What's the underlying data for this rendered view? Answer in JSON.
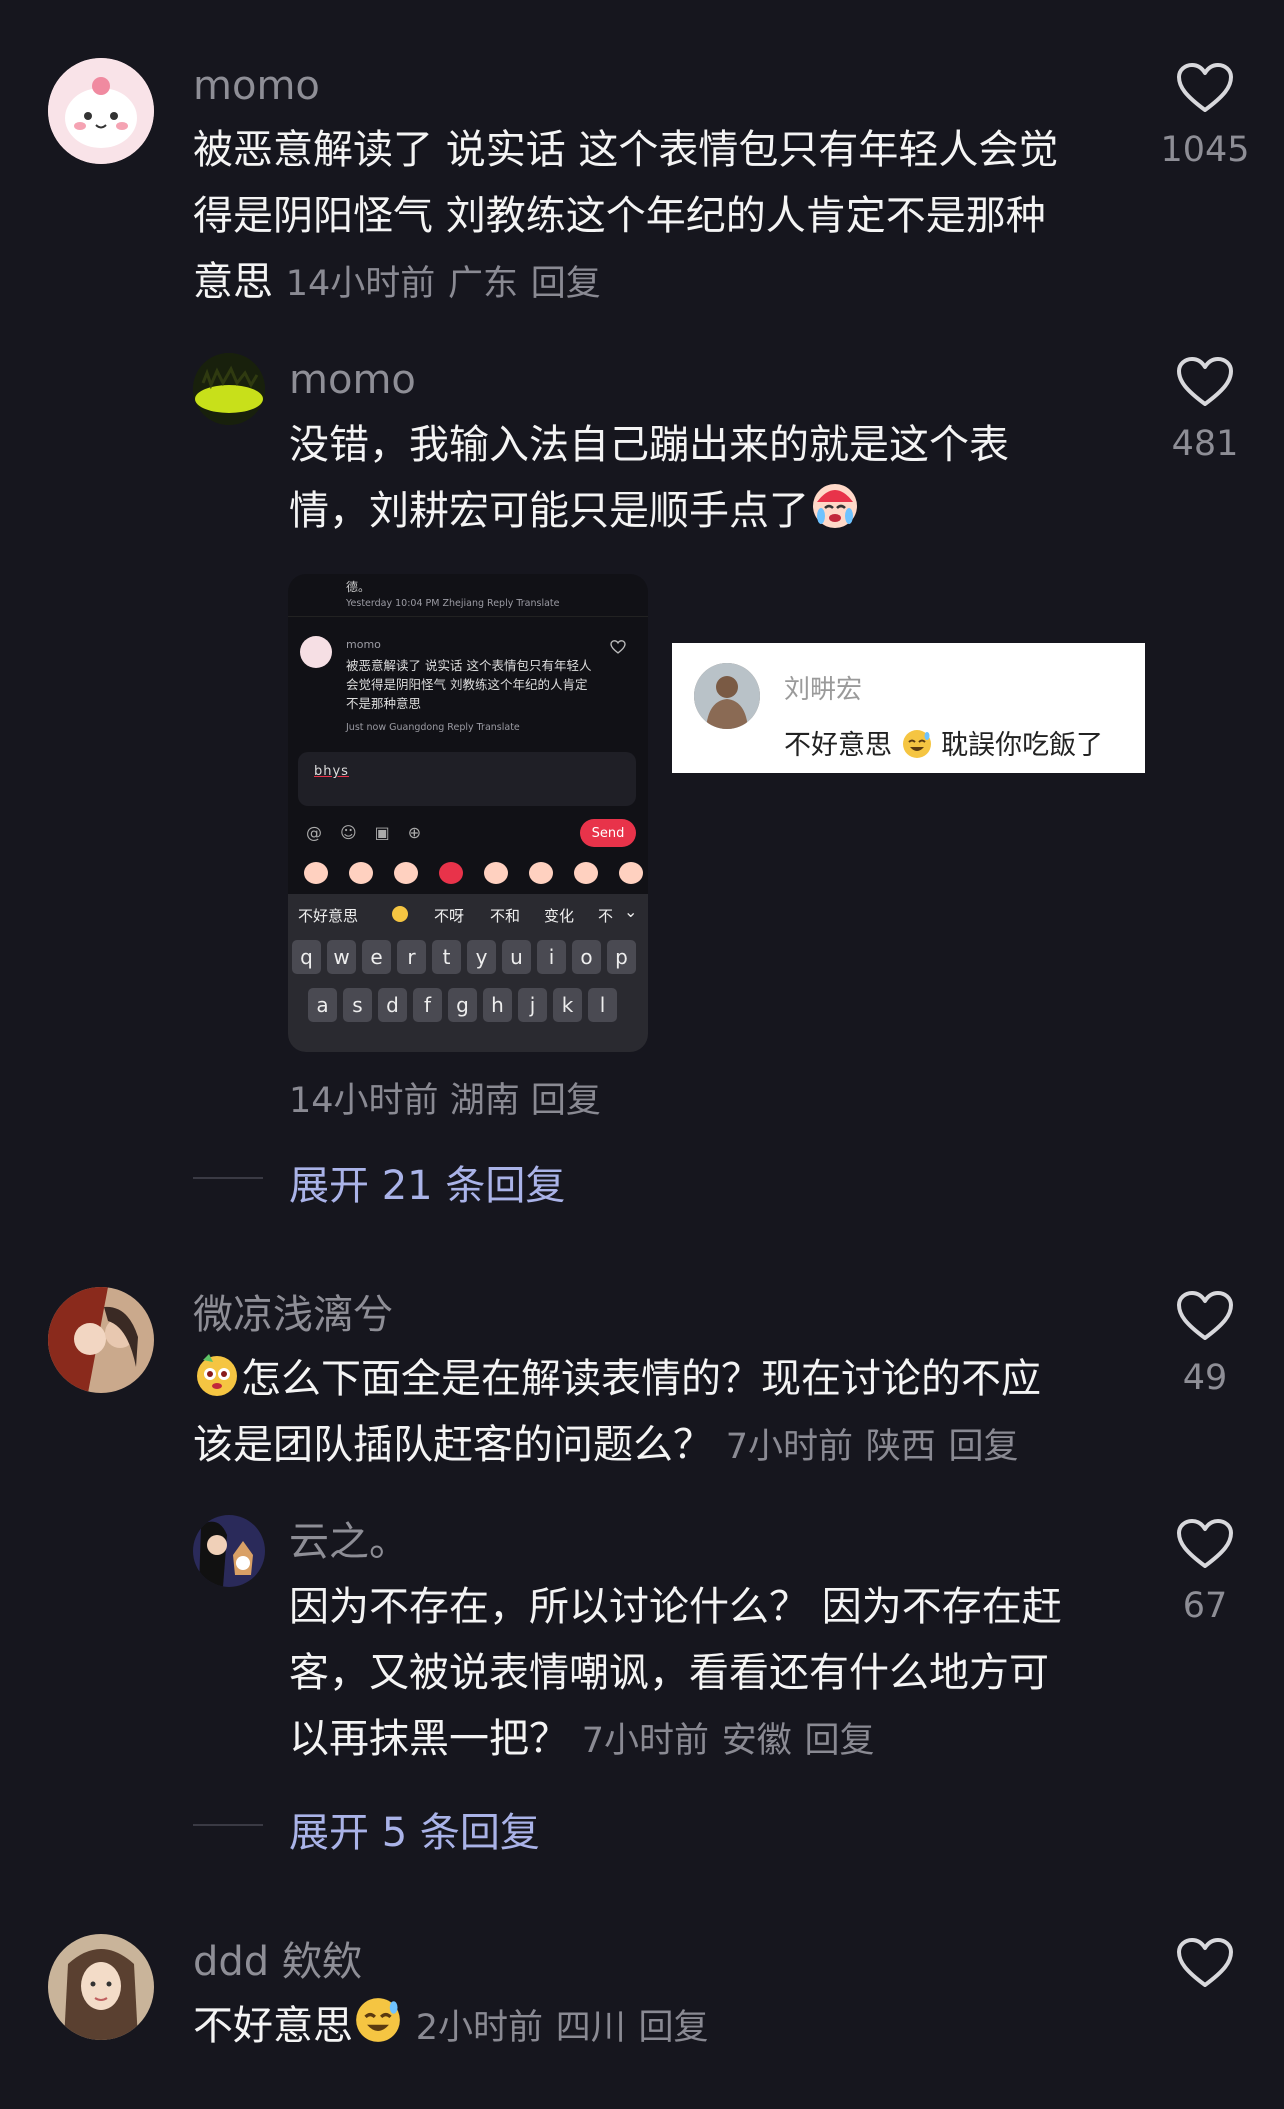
{
  "comments": [
    {
      "username": "momo",
      "text": "被恶意解读了 说实话 这个表情包只有年轻人会觉得是阴阳怪气 刘教练这个年纪的人肯定不是那种意思",
      "line1": "被恶意解读了 说实话 这个表情包只有年轻人会觉",
      "line2": "得是阴阳怪气 刘教练这个年纪的人肯定不是那种",
      "line3": "意思",
      "time": "14小时前",
      "location": "广东",
      "reply": "回复",
      "likes": "1045"
    },
    {
      "username": "momo",
      "line1": "没错，我输入法自己蹦出来的就是这个表",
      "line2": "情，刘耕宏可能只是顺手点了",
      "time": "14小时前",
      "location": "湖南",
      "reply": "回复",
      "likes": "481",
      "screenshot": {
        "top_char": "德。",
        "meta1": "Yesterday 10:04 PM Zhejiang Reply Translate",
        "inner_user": "momo",
        "inner_l1": "被恶意解读了 说实话 这个表情包只有年轻人",
        "inner_l2": "会觉得是阴阳怪气 刘教练这个年纪的人肯定",
        "inner_l3": "不是那种意思",
        "meta2": "Just now Guangdong Reply Translate",
        "input": "bhys",
        "send": "Send",
        "candidates": [
          "不好意思",
          "不呀",
          "不和",
          "变化",
          "不"
        ],
        "row1": [
          "q",
          "w",
          "e",
          "r",
          "t",
          "y",
          "u",
          "i",
          "o",
          "p"
        ],
        "row2": [
          "a",
          "s",
          "d",
          "f",
          "g",
          "h",
          "j",
          "k",
          "l"
        ]
      },
      "card": {
        "name": "刘畊宏",
        "text_before": "不好意思",
        "text_after": "耽誤你吃飯了"
      }
    },
    {
      "expand": "展开 21 条回复"
    },
    {
      "username": "微凉浅漓兮",
      "line1": "怎么下面全是在解读表情的？现在讨论的不应",
      "line2": "该是团队插队赶客的问题么？",
      "time": "7小时前",
      "location": "陕西",
      "reply": "回复",
      "likes": "49"
    },
    {
      "username": "云之。",
      "line1": "因为不存在，所以讨论什么？ 因为不存在赶",
      "line2": "客，又被说表情嘲讽，看看还有什么地方可",
      "line3": "以再抹黑一把？",
      "time": "7小时前",
      "location": "安徽",
      "reply": "回复",
      "likes": "67"
    },
    {
      "expand": "展开 5 条回复"
    },
    {
      "username": "ddd 欸欸",
      "line1": "不好意思",
      "time": "2小时前",
      "location": "四川",
      "reply": "回复"
    }
  ],
  "colors": {
    "background": "#16161e",
    "username": "#8e8e96",
    "text": "#f4f4f4",
    "meta": "#8a8a93",
    "expand": "#aab3e8",
    "send_button": "#e8334a"
  },
  "icons": [
    "heart-icon",
    "avatar",
    "emoji-crying-icon",
    "emoji-sweat-smile-icon",
    "emoji-dog-icon"
  ]
}
